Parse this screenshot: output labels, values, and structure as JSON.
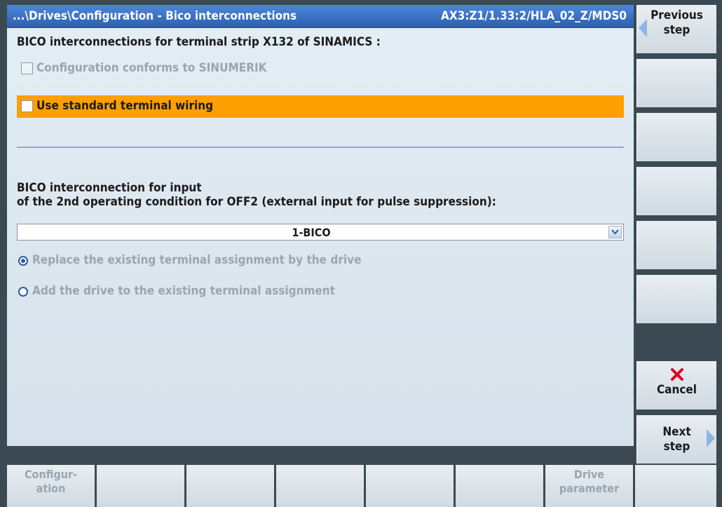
{
  "title_bar": {
    "path": "...\\Drives\\Configuration - Bico interconnections",
    "context": "AX3:Z1/1.33:2/HLA_02_Z/MDS0"
  },
  "main": {
    "heading": "BICO interconnections for terminal strip X132 of SINAMICS :",
    "checkbox_conform": {
      "label": "Configuration conforms to SINUMERIK",
      "checked": false,
      "enabled": false
    },
    "checkbox_standard": {
      "label": "Use standard terminal wiring",
      "checked": false,
      "enabled": true
    },
    "input_label_1": "BICO interconnection for input",
    "input_label_2": "of the 2nd operating condition for OFF2 (external input for pulse suppression):",
    "dropdown": {
      "value": "1-BICO"
    },
    "radio_replace": {
      "label": "Replace the existing terminal assignment by the drive",
      "selected": true
    },
    "radio_add": {
      "label": "Add the drive to the existing terminal assignment",
      "selected": false
    }
  },
  "vertical_softkeys": {
    "previous": {
      "line1": "Previous",
      "line2": "step"
    },
    "cancel": {
      "label": "Cancel"
    },
    "next": {
      "line1": "Next",
      "line2": "step"
    }
  },
  "horizontal_softkeys": {
    "configuration": {
      "line1": "Configur-",
      "line2": "ation"
    },
    "drive_parameter": {
      "line1": "Drive",
      "line2": "parameter"
    }
  },
  "colors": {
    "title_bar": "#3a6fc4",
    "selection": "#ff9f00",
    "panel": "#dde7ef",
    "cancel_icon": "#e0001b"
  }
}
